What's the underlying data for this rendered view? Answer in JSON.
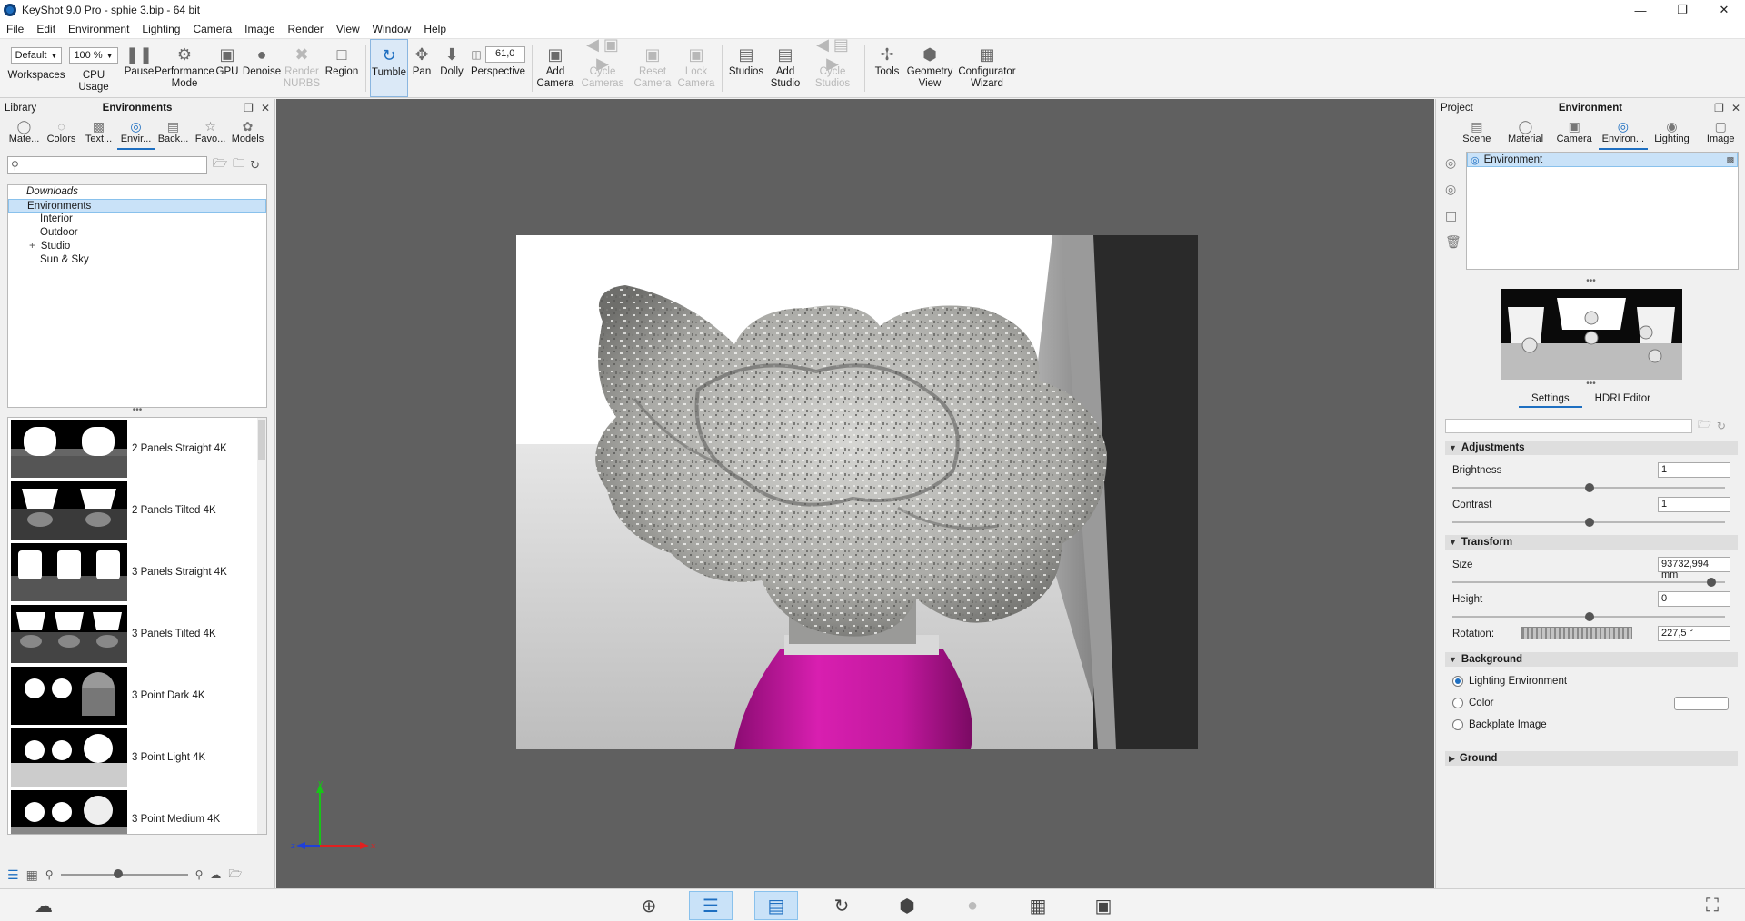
{
  "window": {
    "title": "KeyShot 9.0 Pro  - sphie 3.bip  - 64 bit"
  },
  "menu": [
    "File",
    "Edit",
    "Environment",
    "Lighting",
    "Camera",
    "Image",
    "Render",
    "View",
    "Window",
    "Help"
  ],
  "toolbar": {
    "workspace_value": "Default",
    "cpu_value": "100 %",
    "fov_value": "61,0",
    "items": {
      "workspaces": "Workspaces",
      "cpu_usage": "CPU Usage",
      "pause": "Pause",
      "performance_mode": "Performance\nMode",
      "gpu": "GPU",
      "denoise": "Denoise",
      "render_nurbs": "Render\nNURBS",
      "region": "Region",
      "tumble": "Tumble",
      "pan": "Pan",
      "dolly": "Dolly",
      "perspective": "Perspective",
      "add_camera": "Add\nCamera",
      "cycle_cameras": "Cycle\nCameras",
      "reset_camera": "Reset\nCamera",
      "lock_camera": "Lock\nCamera",
      "studios": "Studios",
      "add_studio": "Add\nStudio",
      "cycle_studios": "Cycle\nStudios",
      "tools": "Tools",
      "geometry_view": "Geometry\nView",
      "configurator_wizard": "Configurator\nWizard"
    }
  },
  "library": {
    "panel_label": "Library",
    "title": "Environments",
    "tabs": [
      "Mate...",
      "Colors",
      "Text...",
      "Envir...",
      "Back...",
      "Favo...",
      "Models"
    ],
    "active_tab": "Envir...",
    "search_placeholder": "",
    "tree": [
      "Downloads",
      "Environments",
      "Interior",
      "Outdoor",
      "Studio",
      "Sun & Sky"
    ],
    "environments": [
      "2 Panels Straight 4K",
      "2 Panels Tilted 4K",
      "3 Panels Straight 4K",
      "3 Panels Tilted 4K",
      "3 Point Dark 4K",
      "3 Point Light 4K",
      "3 Point Medium 4K"
    ]
  },
  "project": {
    "panel_label": "Project",
    "title": "Environment",
    "tabs": [
      "Scene",
      "Material",
      "Camera",
      "Environ...",
      "Lighting",
      "Image"
    ],
    "active_tab": "Environ...",
    "env_list": [
      "Environment"
    ],
    "subtabs": [
      "Settings",
      "HDRI Editor"
    ],
    "adjustments": {
      "header": "Adjustments",
      "brightness_label": "Brightness",
      "brightness_value": "1",
      "contrast_label": "Contrast",
      "contrast_value": "1"
    },
    "transform": {
      "header": "Transform",
      "size_label": "Size",
      "size_value": "93732,994 mm",
      "height_label": "Height",
      "height_value": "0",
      "rotation_label": "Rotation:",
      "rotation_value": "227,5 °"
    },
    "background": {
      "header": "Background",
      "options": [
        "Lighting Environment",
        "Color",
        "Backplate Image"
      ],
      "selected": "Lighting Environment"
    },
    "ground": {
      "header": "Ground"
    }
  },
  "colors": {
    "accent": "#1e6fc1",
    "selection": "#c9e2f8",
    "viewport": "#606060",
    "bottle": "#c2189e"
  }
}
